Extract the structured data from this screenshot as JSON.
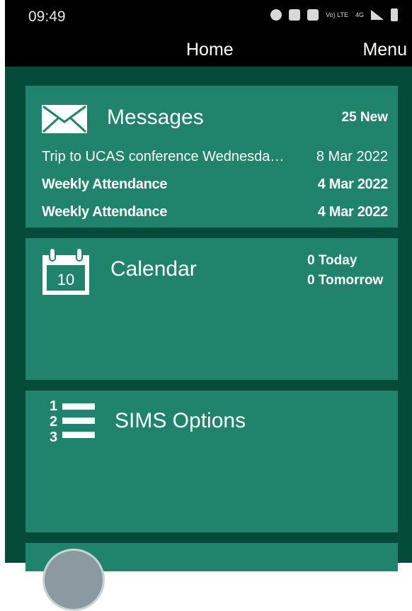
{
  "status": {
    "time": "09:49",
    "network": "4G",
    "lte": "Vo) LTE"
  },
  "app": {
    "title": "Home",
    "menu_label": "Menu"
  },
  "messages": {
    "title": "Messages",
    "count": "25 New",
    "items": [
      {
        "subject": "Trip to UCAS conference Wednesda…",
        "date": "8 Mar 2022",
        "unread": false
      },
      {
        "subject": "Weekly Attendance",
        "date": "4 Mar 2022",
        "unread": true
      },
      {
        "subject": "Weekly Attendance",
        "date": "4 Mar 2022",
        "unread": true
      }
    ]
  },
  "calendar": {
    "title": "Calendar",
    "icon_day": "10",
    "today": "0 Today",
    "tomorrow": "0 Tomorrow"
  },
  "sims": {
    "title": "SIMS Options",
    "icon_numbers": [
      "1",
      "2",
      "3"
    ]
  },
  "colors": {
    "background": "#054b3a",
    "card": "#20846c",
    "bar": "#000000"
  }
}
